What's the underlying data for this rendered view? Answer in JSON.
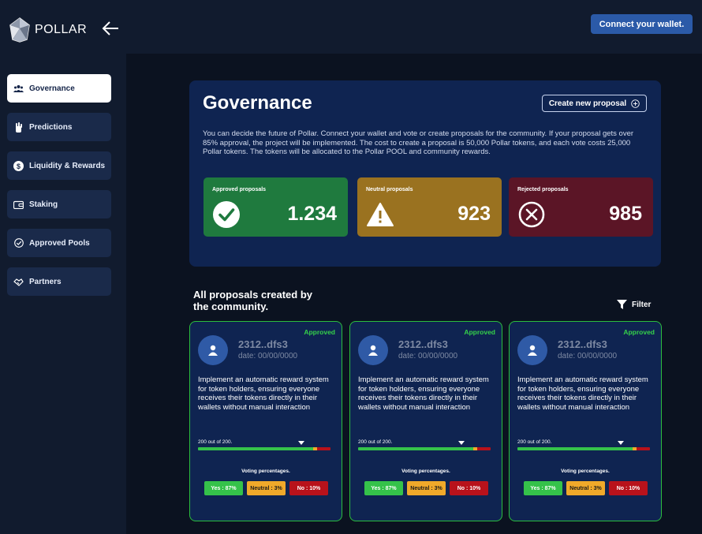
{
  "app": {
    "logo_text": "POLLAR"
  },
  "header": {
    "connect_label": "Connect your wallet."
  },
  "sidebar": {
    "items": [
      {
        "label": "Governance",
        "icon": "people-icon",
        "active": true
      },
      {
        "label": "Predictions",
        "icon": "hand-icon",
        "active": false
      },
      {
        "label": "Liquidity & Rewards",
        "icon": "dollar-icon",
        "active": false
      },
      {
        "label": "Staking",
        "icon": "wallet-icon",
        "active": false
      },
      {
        "label": "Approved Pools",
        "icon": "check-circle-icon",
        "active": false
      },
      {
        "label": "Partners",
        "icon": "handshake-icon",
        "active": false
      }
    ]
  },
  "governance": {
    "title": "Governance",
    "create_label": "Create new proposal",
    "description": "You can decide the future of Pollar. Connect your wallet and vote or create proposals for the community. If your proposal gets over 85% approval, the project will be implemented. The cost to create a proposal is 50,000 Pollar tokens, and each vote costs 25,000 Pollar tokens. The tokens will be allocated to the Pollar POOL and community rewards.",
    "stats": [
      {
        "label": "Approved proposals",
        "value": "1.234",
        "color": "#1f7a3e",
        "icon": "check-icon"
      },
      {
        "label": "Neutral proposals",
        "value": "923",
        "color": "#9a7220",
        "icon": "warning-icon"
      },
      {
        "label": "Rejected proposals",
        "value": "985",
        "color": "#5b1526",
        "icon": "x-circle-icon"
      }
    ]
  },
  "proposals_section": {
    "title": "All proposals created by the community.",
    "filter_label": "Filter"
  },
  "proposals": [
    {
      "status": "Approved",
      "id": "2312..dfs3",
      "date": "date: 00/00/0000",
      "description": "Implement an automatic reward system for token holders, ensuring everyone receives their tokens directly in their wallets without manual interaction",
      "vote_count": "200 out of 200.",
      "voting_label": "Voting percentages.",
      "yes": "Yes : 87%",
      "neutral": "Neutral : 3%",
      "no": "No : 10%",
      "yes_pct": 87,
      "neutral_pct": 3,
      "no_pct": 10
    },
    {
      "status": "Approved",
      "id": "2312..dfs3",
      "date": "date: 00/00/0000",
      "description": "Implement an automatic reward system for token holders, ensuring everyone receives their tokens directly in their wallets without manual interaction",
      "vote_count": "200 out of 200.",
      "voting_label": "Voting percentages.",
      "yes": "Yes : 87%",
      "neutral": "Neutral : 3%",
      "no": "No : 10%",
      "yes_pct": 87,
      "neutral_pct": 3,
      "no_pct": 10
    },
    {
      "status": "Approved",
      "id": "2312..dfs3",
      "date": "date: 00/00/0000",
      "description": "Implement an automatic reward system for token holders, ensuring everyone receives their tokens directly in their wallets without manual interaction",
      "vote_count": "200 out of 200.",
      "voting_label": "Voting percentages.",
      "yes": "Yes : 87%",
      "neutral": "Neutral : 3%",
      "no": "No : 10%",
      "yes_pct": 87,
      "neutral_pct": 3,
      "no_pct": 10
    }
  ],
  "colors": {
    "accent": "#2b5aa8",
    "panel": "#0f2451",
    "approved_border": "#2bbd3e",
    "yes": "#35c24a",
    "neutral": "#f0a92a",
    "no": "#b8121b"
  }
}
